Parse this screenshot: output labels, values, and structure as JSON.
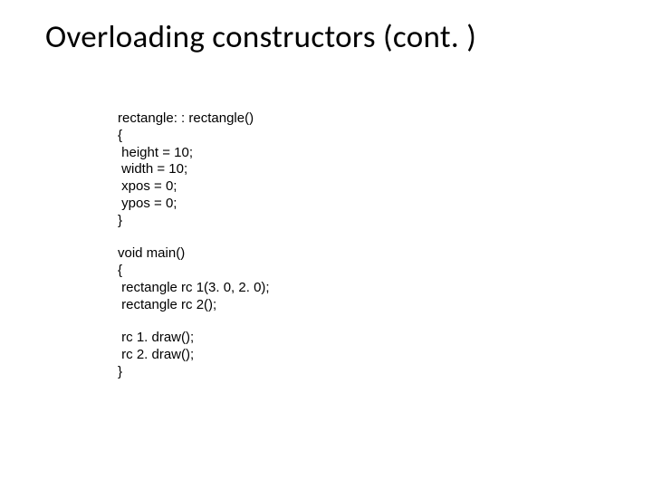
{
  "title": "Overloading constructors (cont. )",
  "code": {
    "block1": "rectangle: : rectangle()\n{\n height = 10;\n width = 10;\n xpos = 0;\n ypos = 0;\n}",
    "block2": "void main()\n{\n rectangle rc 1(3. 0, 2. 0);\n rectangle rc 2();",
    "block3": " rc 1. draw();\n rc 2. draw();\n}"
  }
}
